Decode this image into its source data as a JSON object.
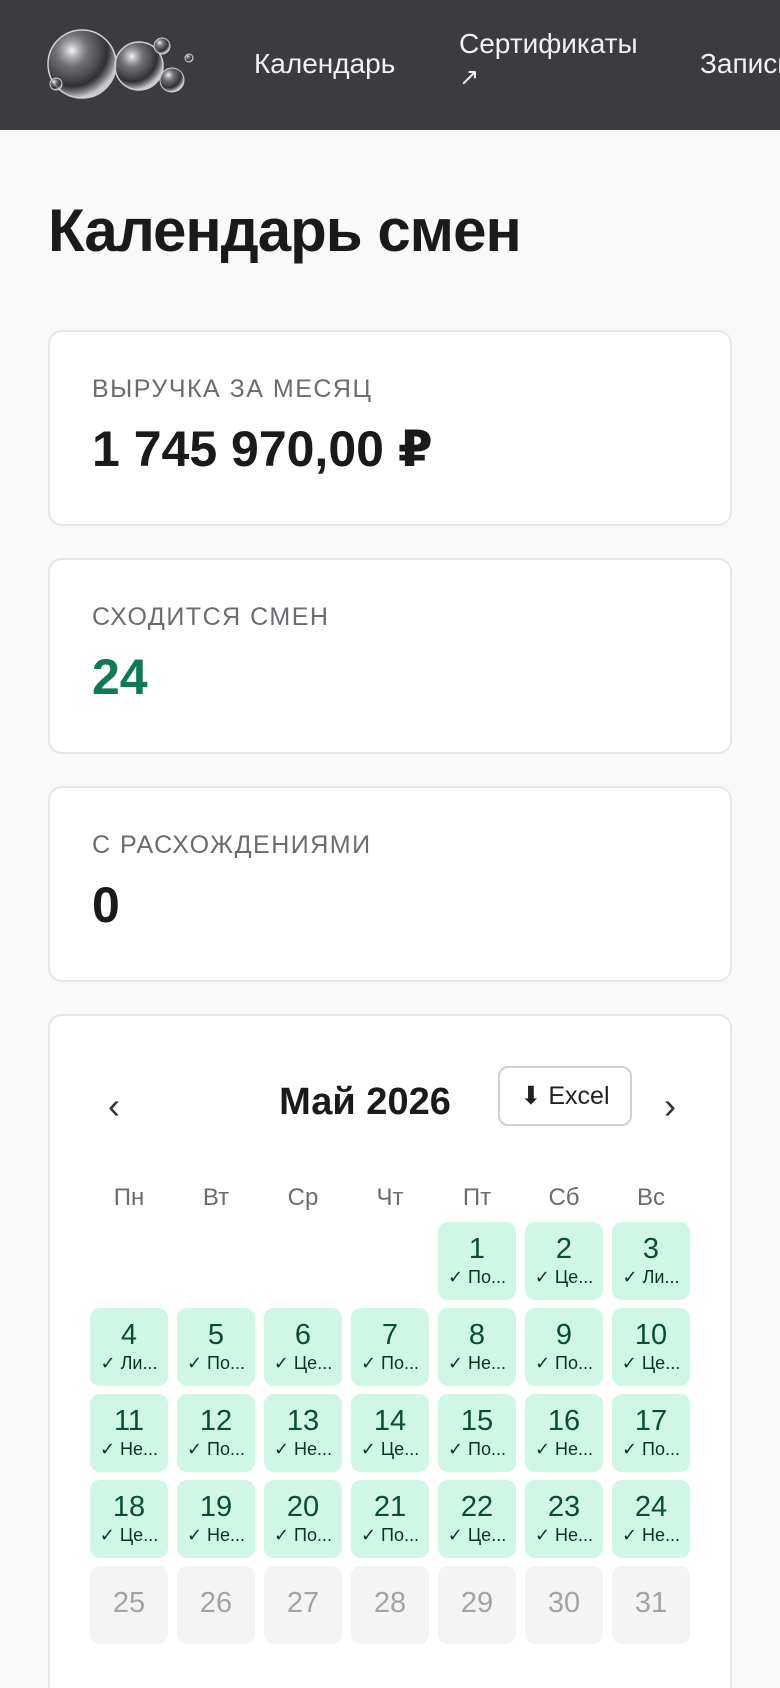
{
  "nav": {
    "items": [
      {
        "label": "Календарь"
      },
      {
        "label": "Сертификаты",
        "ext": "↗"
      },
      {
        "label": "Записи"
      }
    ]
  },
  "page": {
    "title": "Календарь смен"
  },
  "stats": [
    {
      "label": "ВЫРУЧКА ЗА МЕСЯЦ",
      "value": "1 745 970,00 ₽"
    },
    {
      "label": "СХОДИТСЯ СМЕН",
      "value": "24",
      "color": "#0d7a55"
    },
    {
      "label": "С РАСХОЖДЕНИЯМИ",
      "value": "0"
    }
  ],
  "calendar": {
    "prev": "‹",
    "next": "›",
    "month": "Май 2026",
    "excel_label": "⬇ Excel",
    "weekdays": [
      "Пн",
      "Вт",
      "Ср",
      "Чт",
      "Пт",
      "Сб",
      "Вс"
    ],
    "first_weekday_index": 4,
    "days": [
      {
        "n": "1",
        "note": "✓ По...",
        "status": "ok"
      },
      {
        "n": "2",
        "note": "✓ Це...",
        "status": "ok"
      },
      {
        "n": "3",
        "note": "✓ Ли...",
        "status": "ok"
      },
      {
        "n": "4",
        "note": "✓ Ли...",
        "status": "ok"
      },
      {
        "n": "5",
        "note": "✓ По...",
        "status": "ok"
      },
      {
        "n": "6",
        "note": "✓ Це...",
        "status": "ok"
      },
      {
        "n": "7",
        "note": "✓ По...",
        "status": "ok"
      },
      {
        "n": "8",
        "note": "✓ Не...",
        "status": "ok"
      },
      {
        "n": "9",
        "note": "✓ По...",
        "status": "ok"
      },
      {
        "n": "10",
        "note": "✓ Це...",
        "status": "ok"
      },
      {
        "n": "11",
        "note": "✓ Не...",
        "status": "ok"
      },
      {
        "n": "12",
        "note": "✓ По...",
        "status": "ok"
      },
      {
        "n": "13",
        "note": "✓ Не...",
        "status": "ok"
      },
      {
        "n": "14",
        "note": "✓ Це...",
        "status": "ok"
      },
      {
        "n": "15",
        "note": "✓ По...",
        "status": "ok"
      },
      {
        "n": "16",
        "note": "✓ Не...",
        "status": "ok"
      },
      {
        "n": "17",
        "note": "✓ По...",
        "status": "ok"
      },
      {
        "n": "18",
        "note": "✓ Це...",
        "status": "ok"
      },
      {
        "n": "19",
        "note": "✓ Не...",
        "status": "ok"
      },
      {
        "n": "20",
        "note": "✓ По...",
        "status": "ok"
      },
      {
        "n": "21",
        "note": "✓ По...",
        "status": "ok"
      },
      {
        "n": "22",
        "note": "✓ Це...",
        "status": "ok"
      },
      {
        "n": "23",
        "note": "✓ Не...",
        "status": "ok"
      },
      {
        "n": "24",
        "note": "✓ Не...",
        "status": "ok"
      },
      {
        "n": "25",
        "note": "",
        "status": "empty"
      },
      {
        "n": "26",
        "note": "",
        "status": "empty"
      },
      {
        "n": "27",
        "note": "",
        "status": "empty"
      },
      {
        "n": "28",
        "note": "",
        "status": "empty"
      },
      {
        "n": "29",
        "note": "",
        "status": "empty"
      },
      {
        "n": "30",
        "note": "",
        "status": "empty"
      },
      {
        "n": "31",
        "note": "",
        "status": "empty"
      }
    ]
  }
}
